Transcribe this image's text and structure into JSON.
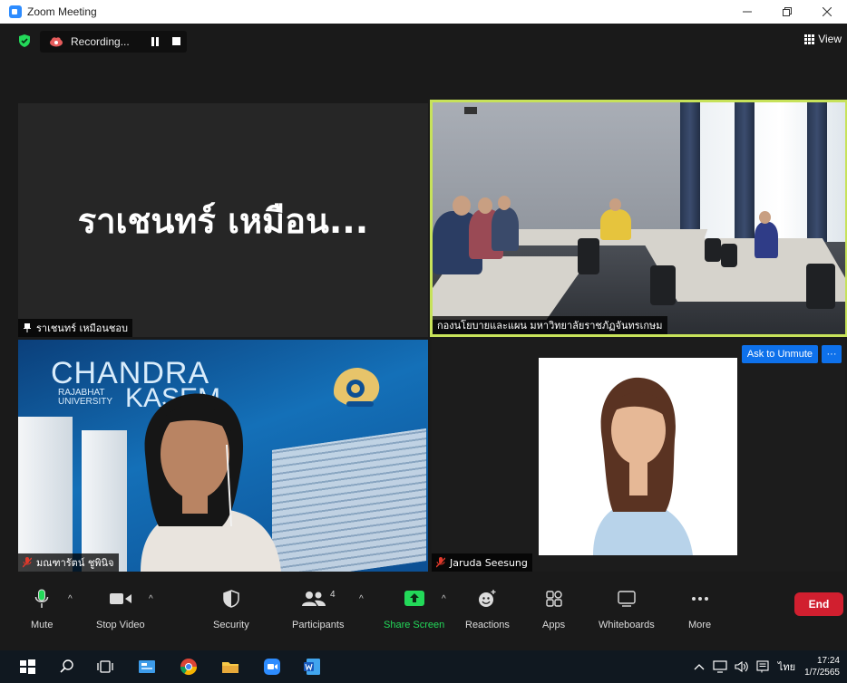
{
  "window": {
    "title": "Zoom Meeting"
  },
  "meeting_top": {
    "recording_label": "Recording...",
    "view_label": "View"
  },
  "tiles": {
    "tile1": {
      "display_name_large": "ราเชนทร์ เหมือน...",
      "name_tag": "ราเชนทร์ เหมือนชอบ"
    },
    "tile2": {
      "name_tag": "กองนโยบายและแผน มหาวิทยาลัยราชภัฏจันทรเกษม"
    },
    "tile3": {
      "name_tag": "มณฑารัตน์ ชูพินิจ",
      "bg_title_line1": "CHANDRA",
      "bg_sub_line1": "RAJABHAT",
      "bg_sub_line2": "UNIVERSITY",
      "bg_title_line2": "KASEM"
    },
    "tile4": {
      "name_tag": "Jaruda Seesung",
      "ask_unmute_label": "Ask to Unmute",
      "more_label": "···"
    }
  },
  "toolbar": {
    "mute_label": "Mute",
    "stop_video_label": "Stop Video",
    "security_label": "Security",
    "participants_label": "Participants",
    "participants_count": "4",
    "share_screen_label": "Share Screen",
    "reactions_label": "Reactions",
    "apps_label": "Apps",
    "whiteboards_label": "Whiteboards",
    "more_label": "More",
    "end_label": "End"
  },
  "taskbar": {
    "language": "ไทย",
    "time": "17:24",
    "date": "1/7/2565"
  },
  "colors": {
    "active_speaker_border": "#c7e25a",
    "end_button": "#d11f2f",
    "share_screen_green": "#23d959",
    "zoom_blue": "#0e71eb"
  }
}
